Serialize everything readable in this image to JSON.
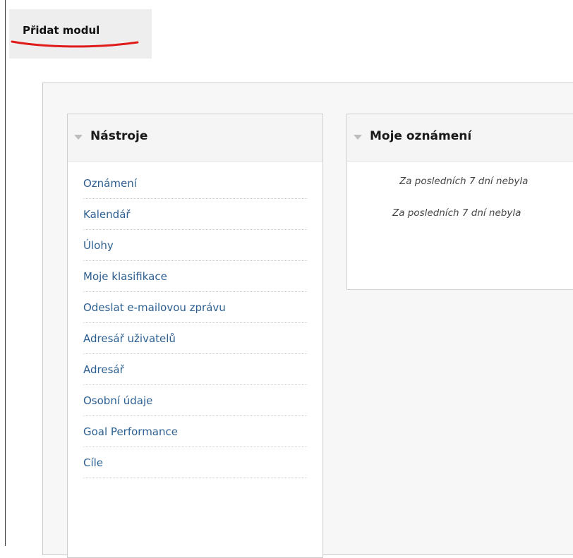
{
  "toolbar": {
    "add_module_label": "Přidat modul"
  },
  "tools_module": {
    "title": "Nástroje",
    "items": [
      {
        "label": "Oznámení"
      },
      {
        "label": "Kalendář"
      },
      {
        "label": "Úlohy"
      },
      {
        "label": "Moje klasifikace"
      },
      {
        "label": "Odeslat e-mailovou zprávu"
      },
      {
        "label": "Adresář uživatelů"
      },
      {
        "label": "Adresář"
      },
      {
        "label": "Osobní údaje"
      },
      {
        "label": "Goal Performance"
      },
      {
        "label": "Cíle"
      }
    ]
  },
  "notices_module": {
    "title": "Moje oznámení",
    "lines": [
      "Za posledních 7 dní nebyla",
      "Za posledních 7 dní nebyla"
    ]
  },
  "colors": {
    "link": "#2c5f91",
    "annotation_underline": "#e01b1b",
    "toolbar_background": "#eeeeee",
    "panel_background": "#f7f7f7",
    "module_border": "#cfcfcf"
  },
  "icons": {
    "module_collapse": "triangle-down-icon"
  }
}
